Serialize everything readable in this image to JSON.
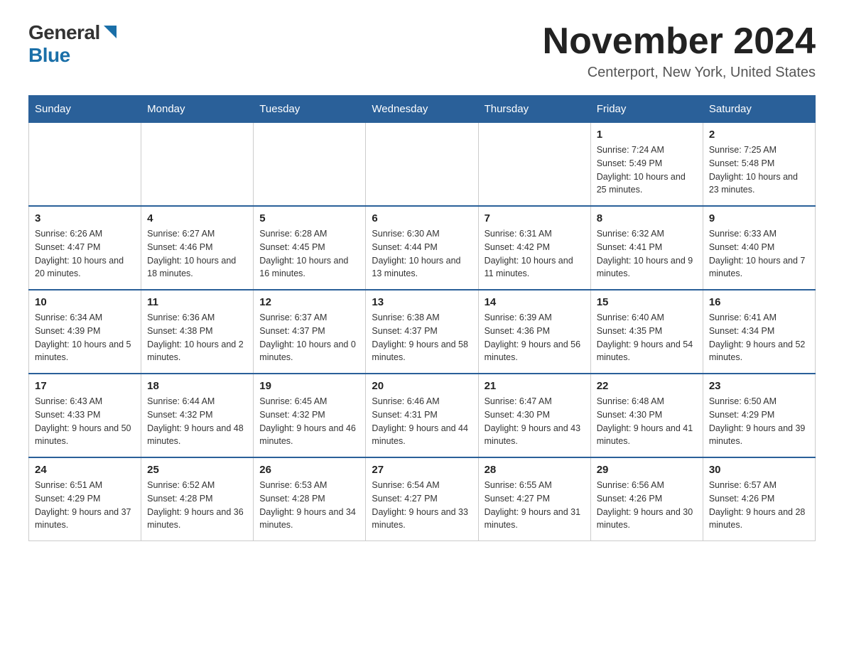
{
  "logo": {
    "general": "General",
    "blue": "Blue"
  },
  "title": "November 2024",
  "subtitle": "Centerport, New York, United States",
  "days_of_week": [
    "Sunday",
    "Monday",
    "Tuesday",
    "Wednesday",
    "Thursday",
    "Friday",
    "Saturday"
  ],
  "weeks": [
    [
      {
        "day": "",
        "info": ""
      },
      {
        "day": "",
        "info": ""
      },
      {
        "day": "",
        "info": ""
      },
      {
        "day": "",
        "info": ""
      },
      {
        "day": "",
        "info": ""
      },
      {
        "day": "1",
        "info": "Sunrise: 7:24 AM\nSunset: 5:49 PM\nDaylight: 10 hours and 25 minutes."
      },
      {
        "day": "2",
        "info": "Sunrise: 7:25 AM\nSunset: 5:48 PM\nDaylight: 10 hours and 23 minutes."
      }
    ],
    [
      {
        "day": "3",
        "info": "Sunrise: 6:26 AM\nSunset: 4:47 PM\nDaylight: 10 hours and 20 minutes."
      },
      {
        "day": "4",
        "info": "Sunrise: 6:27 AM\nSunset: 4:46 PM\nDaylight: 10 hours and 18 minutes."
      },
      {
        "day": "5",
        "info": "Sunrise: 6:28 AM\nSunset: 4:45 PM\nDaylight: 10 hours and 16 minutes."
      },
      {
        "day": "6",
        "info": "Sunrise: 6:30 AM\nSunset: 4:44 PM\nDaylight: 10 hours and 13 minutes."
      },
      {
        "day": "7",
        "info": "Sunrise: 6:31 AM\nSunset: 4:42 PM\nDaylight: 10 hours and 11 minutes."
      },
      {
        "day": "8",
        "info": "Sunrise: 6:32 AM\nSunset: 4:41 PM\nDaylight: 10 hours and 9 minutes."
      },
      {
        "day": "9",
        "info": "Sunrise: 6:33 AM\nSunset: 4:40 PM\nDaylight: 10 hours and 7 minutes."
      }
    ],
    [
      {
        "day": "10",
        "info": "Sunrise: 6:34 AM\nSunset: 4:39 PM\nDaylight: 10 hours and 5 minutes."
      },
      {
        "day": "11",
        "info": "Sunrise: 6:36 AM\nSunset: 4:38 PM\nDaylight: 10 hours and 2 minutes."
      },
      {
        "day": "12",
        "info": "Sunrise: 6:37 AM\nSunset: 4:37 PM\nDaylight: 10 hours and 0 minutes."
      },
      {
        "day": "13",
        "info": "Sunrise: 6:38 AM\nSunset: 4:37 PM\nDaylight: 9 hours and 58 minutes."
      },
      {
        "day": "14",
        "info": "Sunrise: 6:39 AM\nSunset: 4:36 PM\nDaylight: 9 hours and 56 minutes."
      },
      {
        "day": "15",
        "info": "Sunrise: 6:40 AM\nSunset: 4:35 PM\nDaylight: 9 hours and 54 minutes."
      },
      {
        "day": "16",
        "info": "Sunrise: 6:41 AM\nSunset: 4:34 PM\nDaylight: 9 hours and 52 minutes."
      }
    ],
    [
      {
        "day": "17",
        "info": "Sunrise: 6:43 AM\nSunset: 4:33 PM\nDaylight: 9 hours and 50 minutes."
      },
      {
        "day": "18",
        "info": "Sunrise: 6:44 AM\nSunset: 4:32 PM\nDaylight: 9 hours and 48 minutes."
      },
      {
        "day": "19",
        "info": "Sunrise: 6:45 AM\nSunset: 4:32 PM\nDaylight: 9 hours and 46 minutes."
      },
      {
        "day": "20",
        "info": "Sunrise: 6:46 AM\nSunset: 4:31 PM\nDaylight: 9 hours and 44 minutes."
      },
      {
        "day": "21",
        "info": "Sunrise: 6:47 AM\nSunset: 4:30 PM\nDaylight: 9 hours and 43 minutes."
      },
      {
        "day": "22",
        "info": "Sunrise: 6:48 AM\nSunset: 4:30 PM\nDaylight: 9 hours and 41 minutes."
      },
      {
        "day": "23",
        "info": "Sunrise: 6:50 AM\nSunset: 4:29 PM\nDaylight: 9 hours and 39 minutes."
      }
    ],
    [
      {
        "day": "24",
        "info": "Sunrise: 6:51 AM\nSunset: 4:29 PM\nDaylight: 9 hours and 37 minutes."
      },
      {
        "day": "25",
        "info": "Sunrise: 6:52 AM\nSunset: 4:28 PM\nDaylight: 9 hours and 36 minutes."
      },
      {
        "day": "26",
        "info": "Sunrise: 6:53 AM\nSunset: 4:28 PM\nDaylight: 9 hours and 34 minutes."
      },
      {
        "day": "27",
        "info": "Sunrise: 6:54 AM\nSunset: 4:27 PM\nDaylight: 9 hours and 33 minutes."
      },
      {
        "day": "28",
        "info": "Sunrise: 6:55 AM\nSunset: 4:27 PM\nDaylight: 9 hours and 31 minutes."
      },
      {
        "day": "29",
        "info": "Sunrise: 6:56 AM\nSunset: 4:26 PM\nDaylight: 9 hours and 30 minutes."
      },
      {
        "day": "30",
        "info": "Sunrise: 6:57 AM\nSunset: 4:26 PM\nDaylight: 9 hours and 28 minutes."
      }
    ]
  ]
}
